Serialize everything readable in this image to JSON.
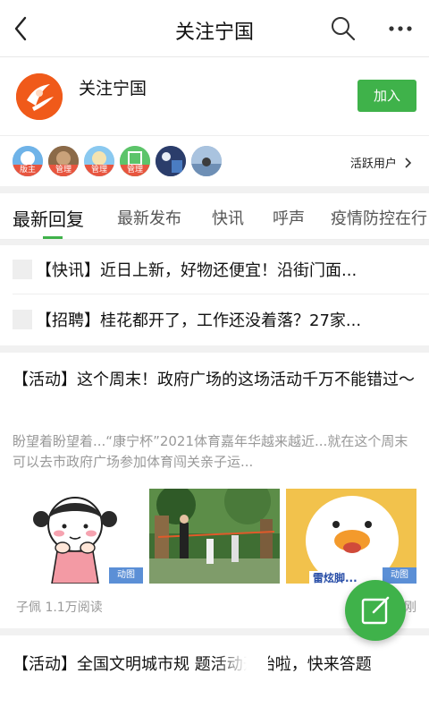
{
  "topbar": {
    "title": "关注宁国",
    "back_icon": "chevron-left-icon",
    "search_icon": "search-icon",
    "more_icon": "more-horizontal-icon"
  },
  "group": {
    "name": "关注宁国",
    "join_label": "加入",
    "logo_color": "#f05a1a",
    "accent_color": "#3fb24a"
  },
  "admins": {
    "items": [
      {
        "badge": "版主"
      },
      {
        "badge": "管理"
      },
      {
        "badge": "管理"
      },
      {
        "badge": "管理"
      },
      {
        "badge": ""
      },
      {
        "badge": ""
      }
    ],
    "active_users_label": "活跃用户"
  },
  "tabs": [
    {
      "label": "最新回复"
    },
    {
      "label": "最新发布"
    },
    {
      "label": "快讯"
    },
    {
      "label": "呼声"
    },
    {
      "label": "疫情防控在行"
    }
  ],
  "notices": [
    {
      "text": "【快讯】近日上新，好物还便宜！沿街门面..."
    },
    {
      "text": "【招聘】桂花都开了，工作还没着落？27家..."
    }
  ],
  "posts": [
    {
      "title": "【活动】这个周末！政府广场的这场活动千万不能错过～",
      "summary": "盼望着盼望着...“康宁杯”2021体育嘉年华越来越近...就在这个周末可以去市政府广场参加体育闯关亲子运...",
      "gif_label": "动图",
      "image3_text": "雷炫脚...",
      "meta": "子佩 1.1万阅读",
      "meta_right": "刚"
    },
    {
      "title": "【活动】全国文明城市规 题活动开始啦，快来答题"
    }
  ],
  "fab_icon": "compose-icon"
}
